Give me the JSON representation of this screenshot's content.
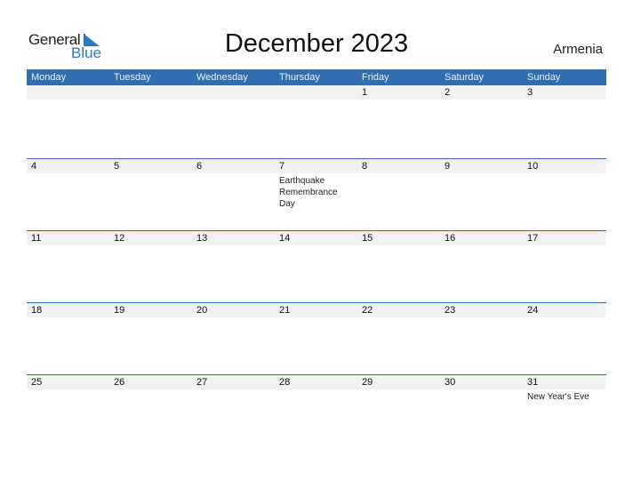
{
  "logo": {
    "general": "General",
    "blue": "Blue"
  },
  "title": "December 2023",
  "country": "Armenia",
  "colors": {
    "header_bg": "#2f6fb1",
    "date_strip": "#f1f1f1",
    "brand_blue": "#2a78c5"
  },
  "weekdays": [
    "Monday",
    "Tuesday",
    "Wednesday",
    "Thursday",
    "Friday",
    "Saturday",
    "Sunday"
  ],
  "weeks": [
    [
      {
        "d": ""
      },
      {
        "d": ""
      },
      {
        "d": ""
      },
      {
        "d": ""
      },
      {
        "d": "1"
      },
      {
        "d": "2"
      },
      {
        "d": "3"
      }
    ],
    [
      {
        "d": "4"
      },
      {
        "d": "5"
      },
      {
        "d": "6"
      },
      {
        "d": "7",
        "e": "Earthquake Remembrance Day"
      },
      {
        "d": "8"
      },
      {
        "d": "9"
      },
      {
        "d": "10"
      }
    ],
    [
      {
        "d": "11"
      },
      {
        "d": "12"
      },
      {
        "d": "13"
      },
      {
        "d": "14"
      },
      {
        "d": "15"
      },
      {
        "d": "16"
      },
      {
        "d": "17"
      }
    ],
    [
      {
        "d": "18"
      },
      {
        "d": "19"
      },
      {
        "d": "20"
      },
      {
        "d": "21"
      },
      {
        "d": "22"
      },
      {
        "d": "23"
      },
      {
        "d": "24"
      }
    ],
    [
      {
        "d": "25"
      },
      {
        "d": "26"
      },
      {
        "d": "27"
      },
      {
        "d": "28"
      },
      {
        "d": "29"
      },
      {
        "d": "30"
      },
      {
        "d": "31",
        "e": "New Year's Eve"
      }
    ]
  ]
}
